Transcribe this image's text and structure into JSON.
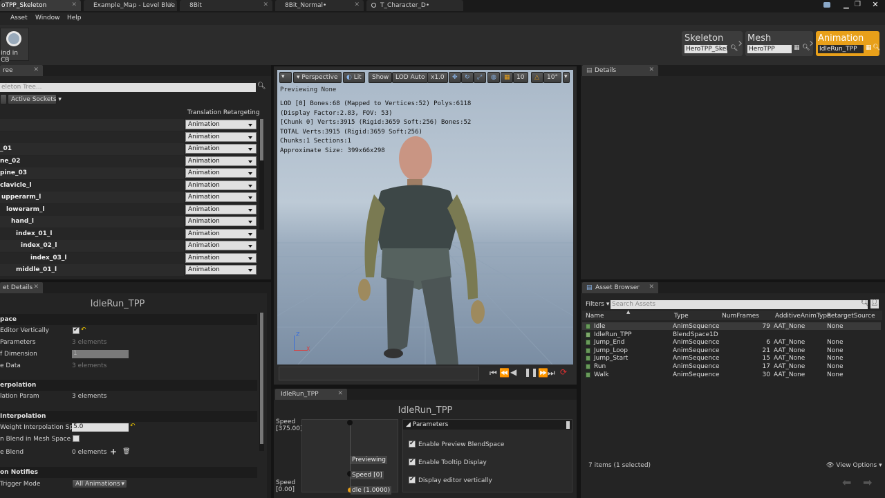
{
  "tabs": [
    {
      "label": "oTPP_Skeleton",
      "active": true
    },
    {
      "label": "Example_Map - Level Blue"
    },
    {
      "label": "8Bit"
    },
    {
      "label": "8Bit_Normal•"
    },
    {
      "label": "T_Character_D•"
    }
  ],
  "menu": {
    "asset": "Asset",
    "window": "Window",
    "help": "Help"
  },
  "toolbar": {
    "find_cb": "ind in CB"
  },
  "modes": {
    "skeleton": {
      "title": "Skeleton",
      "value": "HeroTPP_Skele"
    },
    "mesh": {
      "title": "Mesh",
      "value": "HeroTPP"
    },
    "animation": {
      "title": "Animation",
      "value": "IdleRun_TPP"
    }
  },
  "skeleton_tree": {
    "tab": "ree",
    "search_placeholder": "eleton Tree...",
    "active_sockets": "Active Sockets",
    "column": "Translation Retargeting",
    "bones": [
      "",
      "",
      "_01",
      "ne_02",
      "pine_03",
      "clavicle_l",
      "upperarm_l",
      "lowerarm_l",
      "hand_l",
      "index_01_l",
      "index_02_l",
      "index_03_l",
      "middle_01_l"
    ],
    "retarget": [
      "Animation",
      "Animation",
      "Animation",
      "Animation",
      "Animation",
      "Animation",
      "Animation",
      "Animation",
      "Animation",
      "Animation",
      "Animation",
      "Animation",
      "Animation"
    ]
  },
  "asset_details": {
    "tab": "et Details",
    "title": "IdleRun_TPP",
    "sec1": "pace",
    "editor_vert": "Editor Vertically",
    "params": "Parameters",
    "params_val": "3 elements",
    "of_dim": "f Dimension",
    "of_dim_val": "1",
    "e_data": "e Data",
    "e_data_val": "3 elements",
    "sec2": "erpolation",
    "lation_param": "lation Param",
    "lation_param_val": "3 elements",
    "sec3": "Interpolation",
    "weight": "Weight Interpolation Speed",
    "weight_val": "5.0",
    "mesh_space": "n Blend in Mesh Space",
    "e_blend": "e Blend",
    "e_blend_val": "0 elements",
    "sec4": "on Notifies",
    "trigger": "Trigger Mode",
    "trigger_val": "All Animations"
  },
  "viewport": {
    "perspective": "Perspective",
    "lit": "Lit",
    "show": "Show",
    "lod": "LOD Auto",
    "speed": "x1.0",
    "grid": "10",
    "angle": "10°",
    "previewing": "Previewing None",
    "stats": [
      "LOD [0] Bones:68 (Mapped to Vertices:52) Polys:6118",
      "(Display Factor:2.83, FOV: 53)",
      " [Chunk 0] Verts:3915 (Rigid:3659 Soft:256) Bones:52",
      "TOTAL Verts:3915 (Rigid:3659 Soft:256)",
      "Chunks:1 Sections:1",
      "Approximate Size: 399x66x298"
    ]
  },
  "blendspace": {
    "tab": "IdleRun_TPP",
    "title": "IdleRun_TPP",
    "speed_top": "Speed",
    "speed_top_val": "[375.00]",
    "speed_bottom": "Speed",
    "speed_bottom_val": "[0.00]",
    "previewing": "Previewing",
    "speed_marker": "Speed [0]",
    "idle_marker": "dle (1.0000)",
    "params_header": "Parameters",
    "opt1": "Enable Preview BlendSpace",
    "opt2": "Enable Tooltip Display",
    "opt3": "Display editor vertically"
  },
  "details": {
    "tab": "Details"
  },
  "asset_browser": {
    "tab": "Asset Browser",
    "filters": "Filters",
    "search_placeholder": "Search Assets",
    "columns": [
      "Name",
      "Type",
      "NumFrames",
      "AdditiveAnimType",
      "RetargetSource"
    ],
    "rows": [
      [
        "Idle",
        "AnimSequence",
        "79",
        "AAT_None",
        "None"
      ],
      [
        "IdleRun_TPP",
        "BlendSpace1D",
        "",
        "",
        ""
      ],
      [
        "Jump_End",
        "AnimSequence",
        "6",
        "AAT_None",
        "None"
      ],
      [
        "Jump_Loop",
        "AnimSequence",
        "21",
        "AAT_None",
        "None"
      ],
      [
        "Jump_Start",
        "AnimSequence",
        "15",
        "AAT_None",
        "None"
      ],
      [
        "Run",
        "AnimSequence",
        "17",
        "AAT_None",
        "None"
      ],
      [
        "Walk",
        "AnimSequence",
        "30",
        "AAT_None",
        "None"
      ]
    ],
    "status": "7 items (1 selected)",
    "view_options": "View Options"
  },
  "colors": {
    "accent": "#e8a01a",
    "selected": "#3a3a3a",
    "panel": "#242424"
  }
}
